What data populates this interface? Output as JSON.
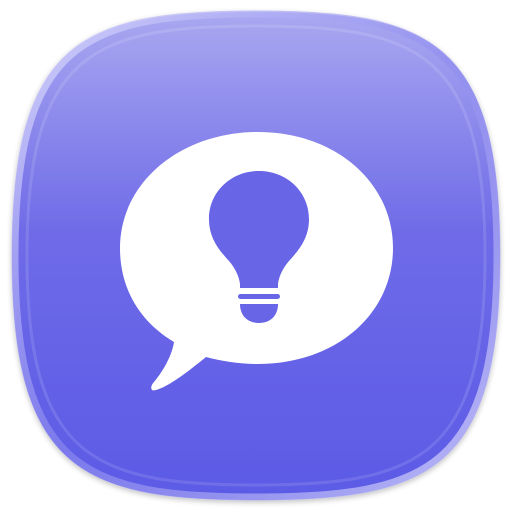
{
  "icon": {
    "name": "speech-bubble-lightbulb-icon",
    "colors": {
      "tile_top": "#a9a8f0",
      "tile_mid": "#6f6be8",
      "tile_bottom": "#5b5ae6",
      "rim_highlight": "#c9c8f8",
      "glyph": "#ffffff",
      "bulb": "#6865e7"
    }
  }
}
